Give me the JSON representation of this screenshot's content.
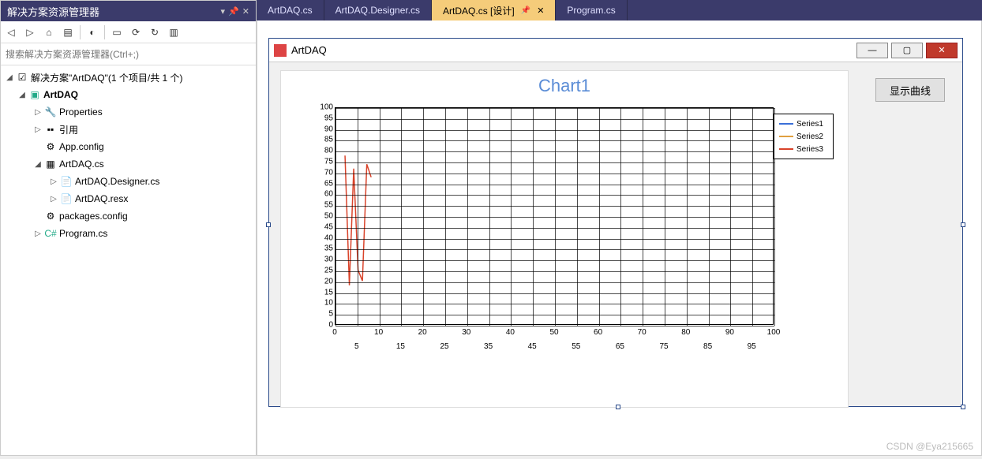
{
  "solution_explorer": {
    "title": "解决方案资源管理器",
    "search_placeholder": "搜索解决方案资源管理器(Ctrl+;)",
    "root": "解决方案\"ArtDAQ\"(1 个项目/共 1 个)",
    "project": "ArtDAQ",
    "items": {
      "properties": "Properties",
      "references": "引用",
      "appconfig": "App.config",
      "artdaq_cs": "ArtDAQ.cs",
      "artdaq_designer": "ArtDAQ.Designer.cs",
      "artdaq_resx": "ArtDAQ.resx",
      "packages": "packages.config",
      "program": "Program.cs"
    }
  },
  "tabs": [
    {
      "label": "ArtDAQ.cs"
    },
    {
      "label": "ArtDAQ.Designer.cs"
    },
    {
      "label": "ArtDAQ.cs [设计]"
    },
    {
      "label": "Program.cs"
    }
  ],
  "form": {
    "title": "ArtDAQ",
    "button_label": "显示曲线"
  },
  "watermark": "CSDN @Eya215665",
  "chart_data": {
    "type": "line",
    "title": "Chart1",
    "xlim": [
      0,
      100
    ],
    "ylim": [
      0,
      100
    ],
    "x_major": [
      0,
      10,
      20,
      30,
      40,
      50,
      60,
      70,
      80,
      90,
      100
    ],
    "x_minor": [
      5,
      15,
      25,
      35,
      45,
      55,
      65,
      75,
      85,
      95
    ],
    "y_ticks": [
      0,
      5,
      10,
      15,
      20,
      25,
      30,
      35,
      40,
      45,
      50,
      55,
      60,
      65,
      70,
      75,
      80,
      85,
      90,
      95,
      100
    ],
    "legend": [
      "Series1",
      "Series2",
      "Series3"
    ],
    "legend_colors": [
      "#3a6fd8",
      "#e0a040",
      "#d9432a"
    ],
    "series": [
      {
        "name": "Series1",
        "x": [],
        "y": []
      },
      {
        "name": "Series2",
        "x": [],
        "y": []
      },
      {
        "name": "Series3",
        "x": [
          2,
          3,
          4,
          5,
          6,
          7,
          8
        ],
        "y": [
          78,
          18,
          72,
          25,
          20,
          74,
          68
        ]
      }
    ]
  }
}
